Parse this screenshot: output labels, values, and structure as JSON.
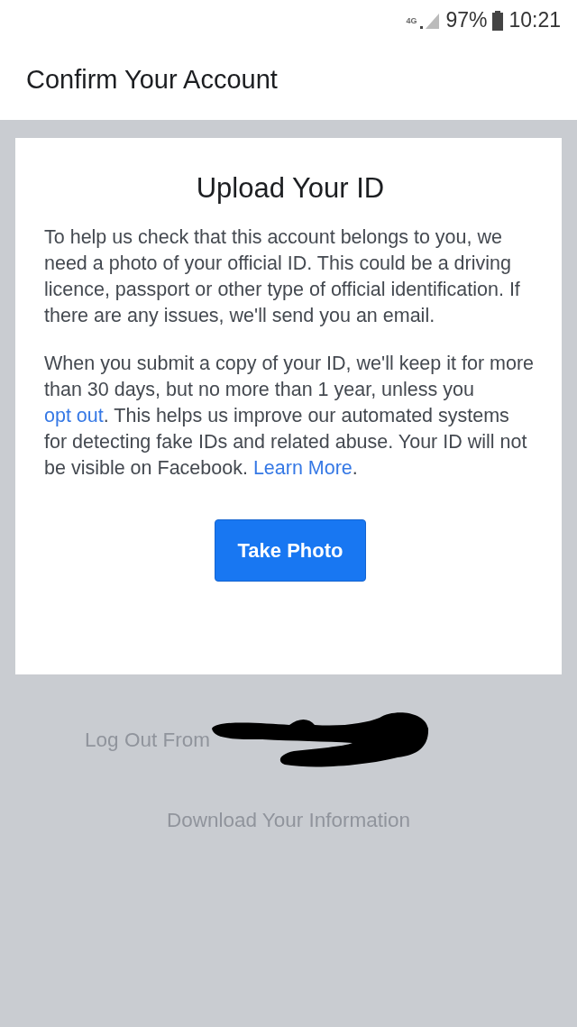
{
  "status_bar": {
    "network": "4G",
    "battery": "97%",
    "time": "10:21"
  },
  "header": {
    "title": "Confirm Your Account"
  },
  "card": {
    "title": "Upload Your ID",
    "paragraphs": [
      {
        "segments": [
          {
            "kind": "text",
            "text": "To help us check that this account belongs to you, we need a photo of your official ID. This could be a driving licence, passport or other type of official identification. If there are any issues, we'll send you an email."
          }
        ]
      },
      {
        "segments": [
          {
            "kind": "text",
            "text": "When you submit a copy of your ID, we'll keep it for more than 30 days, but no more than 1 year, unless you "
          },
          {
            "kind": "link",
            "text": "opt out"
          },
          {
            "kind": "text",
            "text": ". This helps us improve our automated systems for detecting fake IDs and related abuse. Your ID will not be visible on Facebook. "
          },
          {
            "kind": "link",
            "text": "Learn More"
          },
          {
            "kind": "text",
            "text": "."
          }
        ]
      }
    ],
    "button": "Take Photo"
  },
  "links": [
    "Log Out From",
    "Download Your Information"
  ]
}
